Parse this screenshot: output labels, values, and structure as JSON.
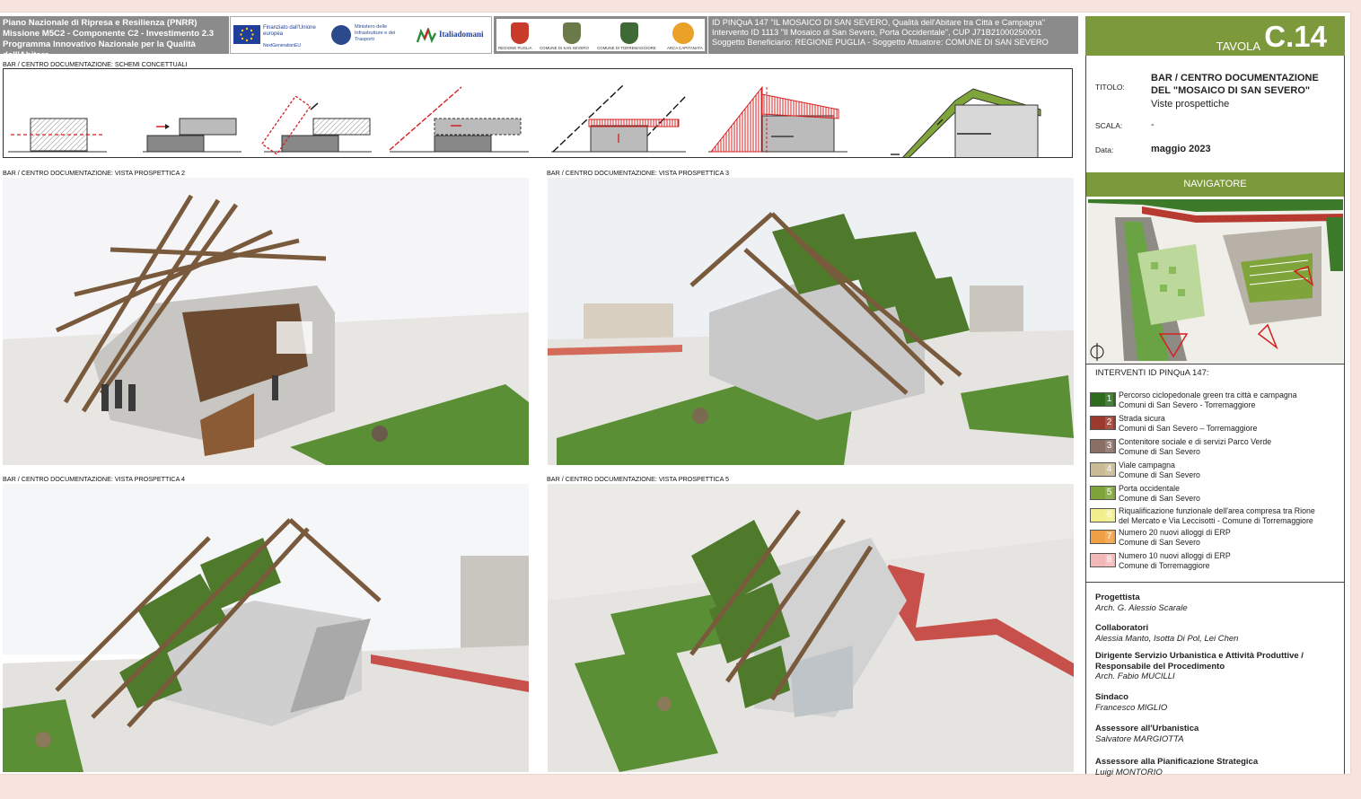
{
  "header": {
    "pnrr_lines": [
      "Piano Nazionale di Ripresa e Resilienza (PNRR)",
      "Missione M5C2 - Componente C2 - Investimento 2.3",
      "Programma Innovativo Nazionale per la Qualità dell'Abitare"
    ],
    "eu_logo_text": "Finanziato dall'Unione europea",
    "eu_logo_sub": "NextGenerationEU",
    "ministry_text": "Ministero delle Infrastrutture e dei Trasporti",
    "italiadomani": "Italiadomani",
    "municipal_logos": [
      "REGIONE PUGLIA",
      "COMUNE DI SAN SEVERO",
      "COMUNE DI TORREMAGGIORE",
      "ARCA CAPITANATA"
    ],
    "id_lines": [
      "ID PINQuA 147  \"IL MOSAICO DI SAN SEVERO, Qualità dell'Abitare tra Città e Campagna\"",
      "Intervento ID 1113 \"Il Mosaico di San Severo, Porta Occidentale\", CUP J71B21000250001",
      "Soggetto Beneficiario: REGIONE PUGLIA  -  Soggetto Attuatore: COMUNE DI SAN SEVERO"
    ],
    "tavola_label": "TAVOLA",
    "tavola_num": "C.14"
  },
  "sections": {
    "schemi": "BAR / CENTRO DOCUMENTAZIONE: SCHEMI CONCETTUALI",
    "vista2": "BAR / CENTRO DOCUMENTAZIONE: VISTA PROSPETTICA 2",
    "vista3": "BAR / CENTRO DOCUMENTAZIONE: VISTA PROSPETTICA 3",
    "vista4": "BAR / CENTRO DOCUMENTAZIONE: VISTA PROSPETTICA 4",
    "vista5": "BAR / CENTRO DOCUMENTAZIONE: VISTA PROSPETTICA 5"
  },
  "info": {
    "titolo_label": "TITOLO:",
    "titolo_line1": "BAR / CENTRO DOCUMENTAZIONE",
    "titolo_line2": "DEL \"MOSAICO DI SAN SEVERO\"",
    "titolo_line3": "Viste prospettiche",
    "scala_label": "SCALA:",
    "scala_value": "-",
    "data_label": "Data:",
    "data_value": "maggio 2023"
  },
  "navigatore": {
    "title": "NAVIGATORE"
  },
  "legend": {
    "title": "INTERVENTI ID PINQuA 147:",
    "items": [
      {
        "n": "1",
        "color": "#2e6b1f",
        "l1": "Percorso ciclopedonale green tra città e campagna",
        "l2": "Comuni di San Severo - Torremaggiore"
      },
      {
        "n": "2",
        "color": "#9c3a2e",
        "l1": "Strada sicura",
        "l2": "Comuni di San Severo – Torremaggiore"
      },
      {
        "n": "3",
        "color": "#8a6f66",
        "l1": "Contenitore sociale e di servizi Parco Verde",
        "l2": "Comune di San Severo"
      },
      {
        "n": "4",
        "color": "#c9bb95",
        "l1": "Viale campagna",
        "l2": "Comune di San Severo"
      },
      {
        "n": "5",
        "color": "#7ea43a",
        "l1": "Porta occidentale",
        "l2": "Comune di San Severo"
      },
      {
        "n": "6",
        "color": "#f1ee8c",
        "l1": "Riqualificazione funzionale dell'area compresa tra Rione",
        "l2": "del Mercato e Via Leccisotti - Comune di  Torremaggiore"
      },
      {
        "n": "7",
        "color": "#f0a044",
        "l1": "Numero 20 nuovi alloggi di ERP",
        "l2": "Comune di San Severo"
      },
      {
        "n": "8",
        "color": "#f2b8b8",
        "l1": "Numero 10 nuovi alloggi di ERP",
        "l2": "Comune di Torremaggiore"
      }
    ]
  },
  "credits": [
    {
      "role": "Progettista",
      "name": "Arch. G. Alessio Scarale"
    },
    {
      "role": "Collaboratori",
      "name": "Alessia Manto, Isotta Di Pol, Lei Chen"
    },
    {
      "role": "Dirigente Servizio Urbanistica e Attività Produttive / Responsabile del Procedimento",
      "name": "Arch. Fabio MUCILLI"
    },
    {
      "role": "Sindaco",
      "name": "Francesco MIGLIO"
    },
    {
      "role": "Assessore all'Urbanistica",
      "name": "Salvatore MARGIOTTA"
    },
    {
      "role": "Assessore alla Pianificazione Strategica",
      "name": "Luigi MONTORIO"
    }
  ],
  "colors": {
    "accent_green": "#7c9a3c",
    "header_grey": "#8b8b8b",
    "red_scheme": "#d42020"
  }
}
